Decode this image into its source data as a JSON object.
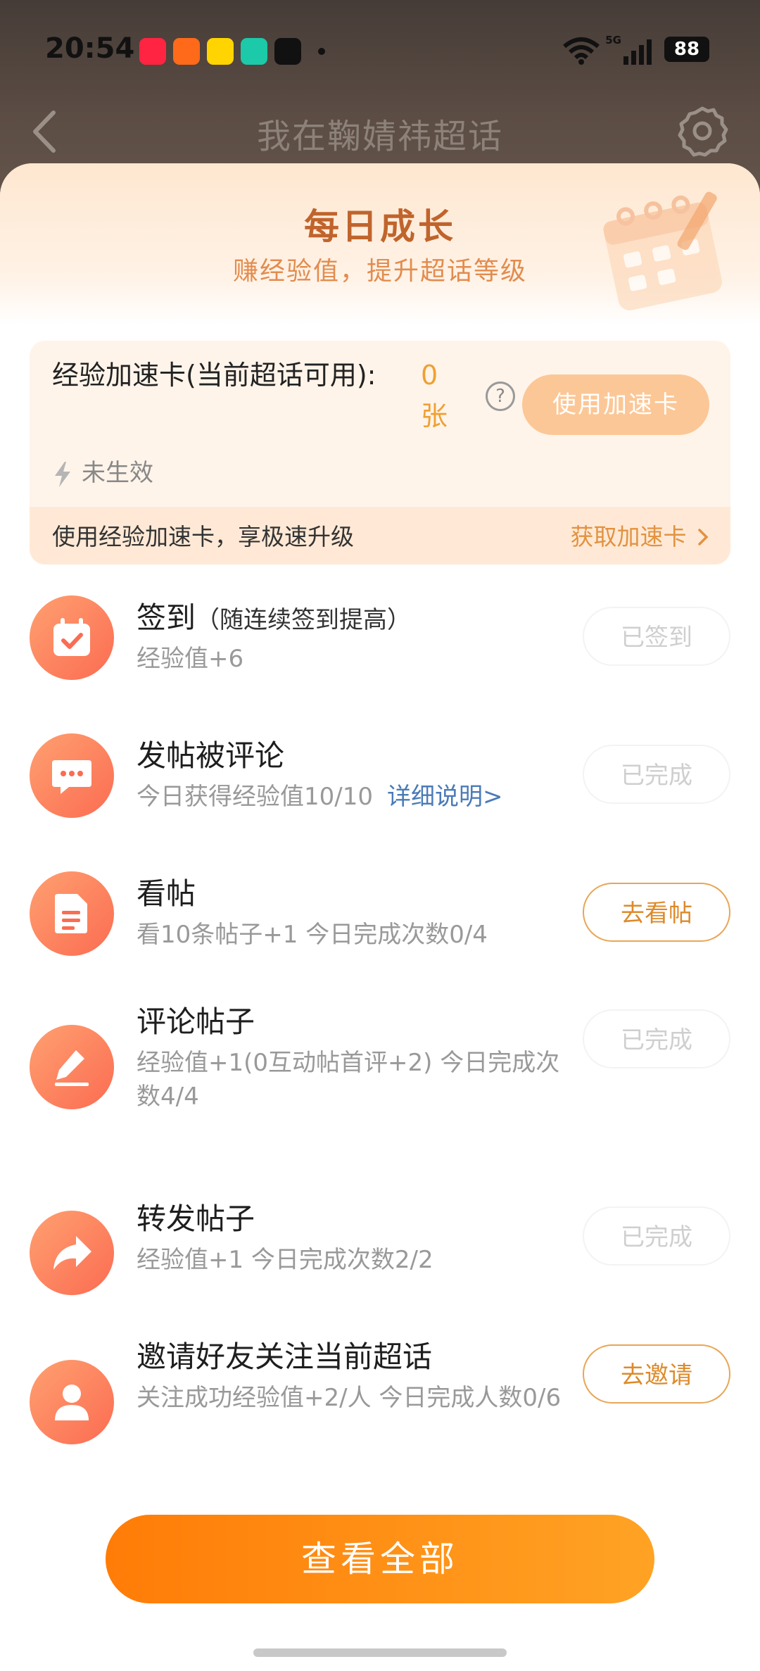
{
  "status_bar": {
    "time": "20:54",
    "network": "5G",
    "battery": "88",
    "apps": [
      "xiaohongshu-icon",
      "app-icon",
      "app-icon",
      "app-icon",
      "tiktok-icon"
    ]
  },
  "nav": {
    "title": "我在鞠婧祎超话"
  },
  "hero": {
    "title": "每日成长",
    "subtitle": "赚经验值，提升超话等级"
  },
  "card": {
    "label": "经验加速卡(当前超话可用):",
    "count": "0",
    "unit": "张",
    "use_button": "使用加速卡",
    "status": "未生效",
    "footer_text": "使用经验加速卡，享极速升级",
    "footer_link": "获取加速卡"
  },
  "tasks": [
    {
      "title": "签到",
      "note": "（随连续签到提高）",
      "desc": "经验值+6",
      "button": "已签到",
      "state": "done",
      "icon": "calendar-check-icon"
    },
    {
      "title": "发帖被评论",
      "note": "",
      "desc": "今日获得经验值10/10",
      "link": "详细说明>",
      "button": "已完成",
      "state": "done",
      "icon": "chat-bubble-icon"
    },
    {
      "title": "看帖",
      "note": "",
      "desc": "看10条帖子+1   今日完成次数0/4",
      "button": "去看帖",
      "state": "go",
      "icon": "document-icon"
    },
    {
      "title": "评论帖子",
      "note": "",
      "desc": "经验值+1(0互动帖首评+2)   今日完成次数4/4",
      "button": "已完成",
      "state": "done",
      "icon": "edit-icon"
    },
    {
      "title": "转发帖子",
      "note": "",
      "desc": "经验值+1   今日完成次数2/2",
      "button": "已完成",
      "state": "done",
      "icon": "share-arrow-icon"
    },
    {
      "title": "邀请好友关注当前超话",
      "note": "",
      "desc": "关注成功经验值+2/人   今日完成人数0/6",
      "button": "去邀请",
      "state": "go",
      "icon": "user-icon"
    }
  ],
  "bottom_button": "查看全部",
  "colors": {
    "accent": "#ff8a0f",
    "icon_gradient_start": "#ffa070",
    "icon_gradient_end": "#fb6c52",
    "link": "#4a7bb8"
  }
}
